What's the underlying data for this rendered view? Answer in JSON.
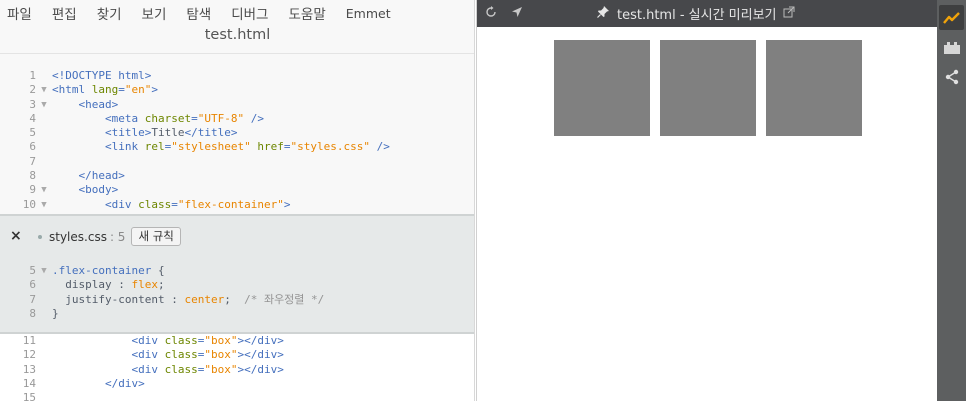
{
  "menu": [
    "파일",
    "편집",
    "찾기",
    "보기",
    "탐색",
    "디버그",
    "도움말",
    "Emmet"
  ],
  "editor": {
    "file_title": "test.html",
    "top_lines": [
      {
        "n": "1",
        "fold": "",
        "t": [
          [
            "tag",
            "<!DOCTYPE html>"
          ]
        ]
      },
      {
        "n": "2",
        "fold": "▼",
        "t": [
          [
            "tag",
            "<html "
          ],
          [
            "attr",
            "lang"
          ],
          [
            "tag",
            "="
          ],
          [
            "str",
            "\"en\""
          ],
          [
            "tag",
            ">"
          ]
        ]
      },
      {
        "n": "3",
        "fold": "▼",
        "t": [
          [
            "txt",
            "    "
          ],
          [
            "tag",
            "<head>"
          ]
        ]
      },
      {
        "n": "4",
        "fold": "",
        "t": [
          [
            "txt",
            "        "
          ],
          [
            "tag",
            "<meta "
          ],
          [
            "attr",
            "charset"
          ],
          [
            "tag",
            "="
          ],
          [
            "str",
            "\"UTF-8\""
          ],
          [
            "tag",
            " />"
          ]
        ]
      },
      {
        "n": "5",
        "fold": "",
        "t": [
          [
            "txt",
            "        "
          ],
          [
            "tag",
            "<title>"
          ],
          [
            "txt",
            "Title"
          ],
          [
            "tag",
            "</title>"
          ]
        ]
      },
      {
        "n": "6",
        "fold": "",
        "t": [
          [
            "txt",
            "        "
          ],
          [
            "tag",
            "<link "
          ],
          [
            "attr",
            "rel"
          ],
          [
            "tag",
            "="
          ],
          [
            "str",
            "\"stylesheet\""
          ],
          [
            "tag",
            " "
          ],
          [
            "attr",
            "href"
          ],
          [
            "tag",
            "="
          ],
          [
            "str",
            "\"styles.css\""
          ],
          [
            "tag",
            " />"
          ]
        ]
      },
      {
        "n": "7",
        "fold": "",
        "t": []
      },
      {
        "n": "8",
        "fold": "",
        "t": [
          [
            "txt",
            "    "
          ],
          [
            "tag",
            "</head>"
          ]
        ]
      },
      {
        "n": "9",
        "fold": "▼",
        "t": [
          [
            "txt",
            "    "
          ],
          [
            "tag",
            "<body>"
          ]
        ]
      },
      {
        "n": "10",
        "fold": "▼",
        "t": [
          [
            "txt",
            "        "
          ],
          [
            "tag",
            "<div "
          ],
          [
            "attr",
            "class"
          ],
          [
            "tag",
            "="
          ],
          [
            "str",
            "\"flex-container\""
          ],
          [
            "tag",
            ">"
          ]
        ]
      }
    ],
    "inline": {
      "close": "×",
      "file": "styles.css",
      "line": ": 5",
      "new_rule": "새 규칙",
      "lines": [
        {
          "n": "5",
          "fold": "▼",
          "t": [
            [
              "tag",
              ".flex-container"
            ],
            [
              "txt",
              " {"
            ]
          ]
        },
        {
          "n": "6",
          "fold": "",
          "t": [
            [
              "prop",
              "  display : "
            ],
            [
              "val",
              "flex"
            ],
            [
              "prop",
              ";"
            ]
          ]
        },
        {
          "n": "7",
          "fold": "",
          "t": [
            [
              "prop",
              "  justify-content : "
            ],
            [
              "val",
              "center"
            ],
            [
              "prop",
              ";  "
            ],
            [
              "cmt",
              "/* 좌우정렬 */"
            ]
          ]
        },
        {
          "n": "8",
          "fold": "",
          "t": [
            [
              "txt",
              "}"
            ]
          ]
        }
      ]
    },
    "bottom_lines": [
      {
        "n": "11",
        "fold": "",
        "t": [
          [
            "txt",
            "            "
          ],
          [
            "tag",
            "<div "
          ],
          [
            "attr",
            "class"
          ],
          [
            "tag",
            "="
          ],
          [
            "str",
            "\"box\""
          ],
          [
            "tag",
            "></div>"
          ]
        ]
      },
      {
        "n": "12",
        "fold": "",
        "t": [
          [
            "txt",
            "            "
          ],
          [
            "tag",
            "<div "
          ],
          [
            "attr",
            "class"
          ],
          [
            "tag",
            "="
          ],
          [
            "str",
            "\"box\""
          ],
          [
            "tag",
            "></div>"
          ]
        ]
      },
      {
        "n": "13",
        "fold": "",
        "t": [
          [
            "txt",
            "            "
          ],
          [
            "tag",
            "<div "
          ],
          [
            "attr",
            "class"
          ],
          [
            "tag",
            "="
          ],
          [
            "str",
            "\"box\""
          ],
          [
            "tag",
            "></div>"
          ]
        ]
      },
      {
        "n": "14",
        "fold": "",
        "t": [
          [
            "txt",
            "        "
          ],
          [
            "tag",
            "</div>"
          ]
        ]
      },
      {
        "n": "15",
        "fold": "",
        "t": []
      }
    ]
  },
  "preview": {
    "title": "test.html - 실시간 미리보기",
    "box_count": 3,
    "box_color": "#808080"
  },
  "toolbar": {
    "icons": [
      "live-preview-icon",
      "extension-manager-icon",
      "share-icon"
    ],
    "live_preview_color": "#f0a30a"
  },
  "colors": {
    "preview_header_bg": "#47484b",
    "editor_bg": "#f8f8f8",
    "inline_panel_bg": "#e6e9e9",
    "toolbar_bg": "#5d5f60",
    "tag": "#446fbd",
    "attr": "#6d8600",
    "string": "#e88501",
    "comment": "#949494"
  }
}
